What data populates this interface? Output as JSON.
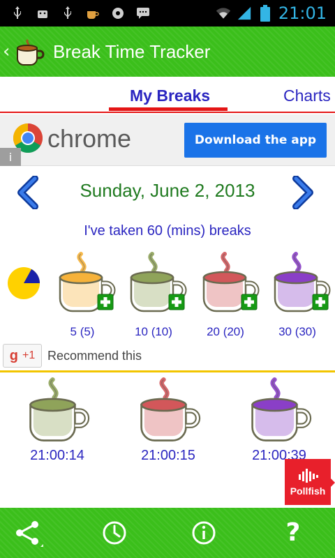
{
  "status_bar": {
    "time": "21:01",
    "icons": [
      "usb-icon",
      "android-debug-icon",
      "usb-icon",
      "coffee-notification-icon",
      "media-icon",
      "message-icon",
      "wifi-icon",
      "signal-icon",
      "battery-icon"
    ]
  },
  "action_bar": {
    "title": "Break Time Tracker"
  },
  "tabs": {
    "items": [
      {
        "label": "My Breaks",
        "selected": true
      },
      {
        "label": "Charts",
        "selected": false
      }
    ]
  },
  "ad": {
    "brand": "chrome",
    "button": "Download the app",
    "info": "i"
  },
  "date_nav": {
    "date": "Sunday, June 2, 2013"
  },
  "summary": {
    "text": "I've taken 60 (mins) breaks"
  },
  "pie": {
    "fraction": 0.17,
    "colors": {
      "filled": "#1a22a8",
      "empty": "#ffd100"
    }
  },
  "cups": [
    {
      "label": "5 (5)",
      "color": "#f6b23a"
    },
    {
      "label": "10 (10)",
      "color": "#8fa35a"
    },
    {
      "label": "20 (20)",
      "color": "#d2575a"
    },
    {
      "label": "30 (30)",
      "color": "#8a3fc7"
    }
  ],
  "recommend": {
    "g": "g",
    "count": "+1",
    "text": "Recommend this"
  },
  "history": [
    {
      "time": "21:00:14",
      "color": "#8fa35a"
    },
    {
      "time": "21:00:15",
      "color": "#d2575a"
    },
    {
      "time": "21:00:39",
      "color": "#8a3fc7"
    }
  ],
  "pollfish": {
    "label": "Pollfish"
  },
  "bottom_bar": {
    "items": [
      "share-icon",
      "clock-icon",
      "info-icon",
      "help-icon"
    ],
    "help_glyph": "?"
  }
}
